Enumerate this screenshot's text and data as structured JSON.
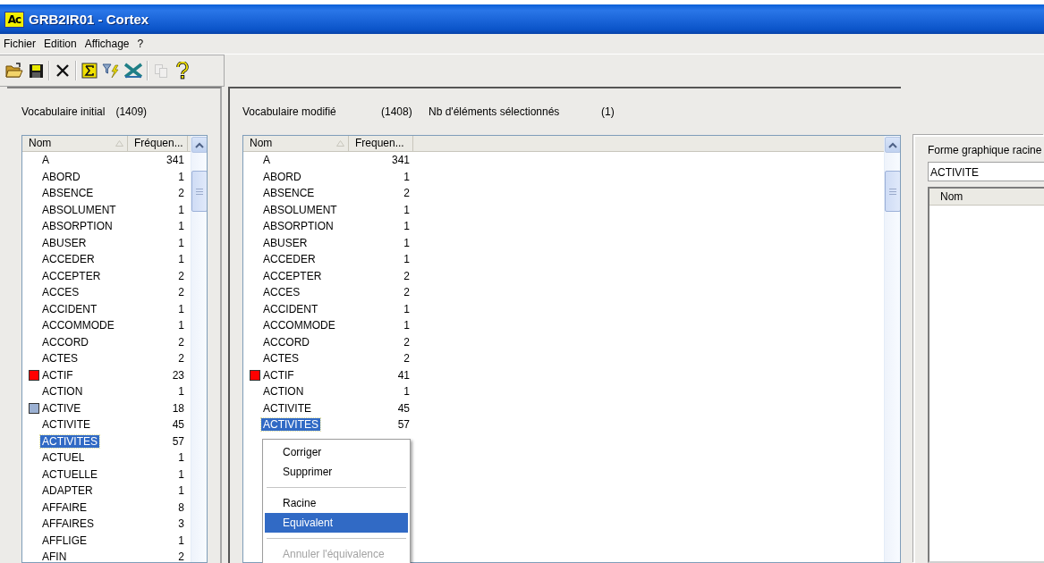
{
  "window": {
    "icon_text": "Ac",
    "title": "GRB2IR01 - Cortex"
  },
  "menu_bar": [
    "Fichier",
    "Edition",
    "Affichage",
    "?"
  ],
  "toolbar": [
    {
      "kind": "open",
      "disabled": false
    },
    {
      "kind": "save",
      "disabled": false
    },
    {
      "kind": "separator"
    },
    {
      "kind": "delete",
      "disabled": false
    },
    {
      "kind": "separator"
    },
    {
      "kind": "sum",
      "disabled": false
    },
    {
      "kind": "filter",
      "disabled": false
    },
    {
      "kind": "cross",
      "disabled": false
    },
    {
      "kind": "separator"
    },
    {
      "kind": "copy",
      "disabled": true
    },
    {
      "kind": "help",
      "disabled": false
    }
  ],
  "initial_vocabulary": {
    "label": "Vocabulaire initial",
    "count": "(1409)",
    "columns": [
      "Nom",
      "Fréquen..."
    ],
    "rows": [
      {
        "name": "A",
        "frequency": "341",
        "selected": false
      },
      {
        "name": "ABORD",
        "frequency": "1",
        "selected": false
      },
      {
        "name": "ABSENCE",
        "frequency": "2",
        "selected": false
      },
      {
        "name": "ABSOLUMENT",
        "frequency": "1",
        "selected": false
      },
      {
        "name": "ABSORPTION",
        "frequency": "1",
        "selected": false
      },
      {
        "name": "ABUSER",
        "frequency": "1",
        "selected": false
      },
      {
        "name": "ACCEDER",
        "frequency": "1",
        "selected": false
      },
      {
        "name": "ACCEPTER",
        "frequency": "2",
        "selected": false
      },
      {
        "name": "ACCES",
        "frequency": "2",
        "selected": false
      },
      {
        "name": "ACCIDENT",
        "frequency": "1",
        "selected": false
      },
      {
        "name": "ACCOMMODE",
        "frequency": "1",
        "selected": false
      },
      {
        "name": "ACCORD",
        "frequency": "2",
        "selected": false
      },
      {
        "name": "ACTES",
        "frequency": "2",
        "selected": false
      },
      {
        "name": "ACTIF",
        "frequency": "23",
        "selected": false,
        "color": "#ff0000"
      },
      {
        "name": "ACTION",
        "frequency": "1",
        "selected": false
      },
      {
        "name": "ACTIVE",
        "frequency": "18",
        "selected": false,
        "color": "#9bb0d2"
      },
      {
        "name": "ACTIVITE",
        "frequency": "45",
        "selected": false
      },
      {
        "name": "ACTIVITES",
        "frequency": "57",
        "selected": true
      },
      {
        "name": "ACTUEL",
        "frequency": "1",
        "selected": false
      },
      {
        "name": "ACTUELLE",
        "frequency": "1",
        "selected": false
      },
      {
        "name": "ADAPTER",
        "frequency": "1",
        "selected": false
      },
      {
        "name": "AFFAIRE",
        "frequency": "8",
        "selected": false
      },
      {
        "name": "AFFAIRES",
        "frequency": "3",
        "selected": false
      },
      {
        "name": "AFFLIGE",
        "frequency": "1",
        "selected": false
      },
      {
        "name": "AFIN",
        "frequency": "2",
        "selected": false
      }
    ]
  },
  "modified_vocabulary": {
    "label": "Vocabulaire modifié",
    "count": "(1408)",
    "selection_label": "Nb d'éléments sélectionnés",
    "selection_count": "(1)",
    "columns": [
      "Nom",
      "Frequen..."
    ],
    "rows": [
      {
        "name": "A",
        "frequency": "341",
        "selected": false
      },
      {
        "name": "ABORD",
        "frequency": "1",
        "selected": false
      },
      {
        "name": "ABSENCE",
        "frequency": "2",
        "selected": false
      },
      {
        "name": "ABSOLUMENT",
        "frequency": "1",
        "selected": false
      },
      {
        "name": "ABSORPTION",
        "frequency": "1",
        "selected": false
      },
      {
        "name": "ABUSER",
        "frequency": "1",
        "selected": false
      },
      {
        "name": "ACCEDER",
        "frequency": "1",
        "selected": false
      },
      {
        "name": "ACCEPTER",
        "frequency": "2",
        "selected": false
      },
      {
        "name": "ACCES",
        "frequency": "2",
        "selected": false
      },
      {
        "name": "ACCIDENT",
        "frequency": "1",
        "selected": false
      },
      {
        "name": "ACCOMMODE",
        "frequency": "1",
        "selected": false
      },
      {
        "name": "ACCORD",
        "frequency": "2",
        "selected": false
      },
      {
        "name": "ACTES",
        "frequency": "2",
        "selected": false
      },
      {
        "name": "ACTIF",
        "frequency": "41",
        "selected": false,
        "color": "#ff0000"
      },
      {
        "name": "ACTION",
        "frequency": "1",
        "selected": false
      },
      {
        "name": "ACTIVITE",
        "frequency": "45",
        "selected": false
      },
      {
        "name": "ACTIVITES",
        "frequency": "57",
        "selected": true
      }
    ]
  },
  "root_form": {
    "label": "Forme graphique racine",
    "value": "ACTIVITE",
    "columns": [
      "Nom"
    ]
  },
  "context_menu": {
    "items": [
      {
        "kind": "item",
        "label": "Corriger",
        "selected": false,
        "disabled": false
      },
      {
        "kind": "item",
        "label": "Supprimer",
        "selected": false,
        "disabled": false
      },
      {
        "kind": "separator"
      },
      {
        "kind": "item",
        "label": "Racine",
        "selected": false,
        "disabled": false
      },
      {
        "kind": "item",
        "label": "Equivalent",
        "selected": true,
        "disabled": false
      },
      {
        "kind": "separator"
      },
      {
        "kind": "item",
        "label": "Annuler l'équivalence",
        "selected": false,
        "disabled": true
      }
    ]
  }
}
